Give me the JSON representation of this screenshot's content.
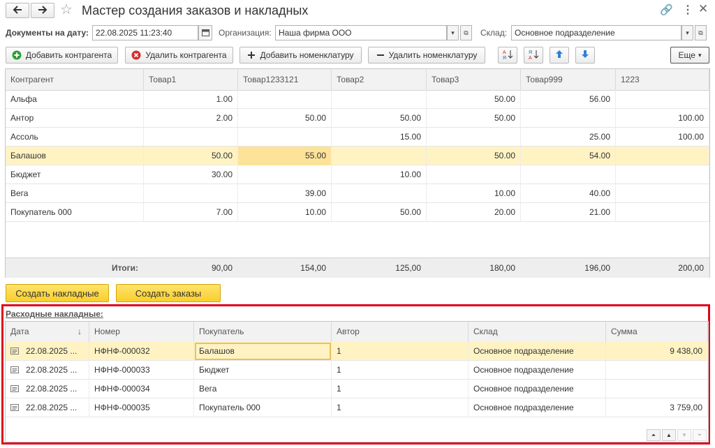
{
  "window": {
    "title": "Мастер создания заказов и накладных"
  },
  "filters": {
    "date_label": "Документы на дату:",
    "date_value": "22.08.2025 11:23:40",
    "org_label": "Организация:",
    "org_value": "Наша фирма ООО",
    "warehouse_label": "Склад:",
    "warehouse_value": "Основное подразделение"
  },
  "toolbar": {
    "add_counterparty": "Добавить контрагента",
    "remove_counterparty": "Удалить контрагента",
    "add_item": "Добавить номенклатуру",
    "remove_item": "Удалить номенклатуру",
    "more": "Еще"
  },
  "matrix": {
    "columns": [
      "Контрагент",
      "Товар1",
      "Товар1233121",
      "Товар2",
      "Товар3",
      "Товар999",
      "1223"
    ],
    "rows": [
      {
        "name": "Альфа",
        "values": [
          "1.00",
          "",
          "",
          "50.00",
          "56.00",
          ""
        ]
      },
      {
        "name": "Антор",
        "values": [
          "2.00",
          "50.00",
          "50.00",
          "50.00",
          "",
          "100.00"
        ]
      },
      {
        "name": "Ассоль",
        "values": [
          "",
          "",
          "15.00",
          "",
          "25.00",
          "100.00"
        ]
      },
      {
        "name": "Балашов",
        "values": [
          "50.00",
          "55.00",
          "",
          "50.00",
          "54.00",
          ""
        ]
      },
      {
        "name": "Бюджет",
        "values": [
          "30.00",
          "",
          "10.00",
          "",
          "",
          ""
        ]
      },
      {
        "name": "Вега",
        "values": [
          "",
          "39.00",
          "",
          "10.00",
          "40.00",
          ""
        ]
      },
      {
        "name": "Покупатель 000",
        "values": [
          "7.00",
          "10.00",
          "50.00",
          "20.00",
          "21.00",
          ""
        ]
      }
    ],
    "totals_label": "Итоги:",
    "totals": [
      "90,00",
      "154,00",
      "125,00",
      "180,00",
      "196,00",
      "200,00"
    ]
  },
  "actions": {
    "create_invoices": "Создать накладные",
    "create_orders": "Создать заказы"
  },
  "invoices": {
    "title": "Расходные накладные:",
    "columns": [
      "Дата",
      "Номер",
      "Покупатель",
      "Автор",
      "Склад",
      "Сумма"
    ],
    "rows": [
      {
        "date": "22.08.2025 ...",
        "number": "НФНФ-000032",
        "buyer": "Балашов",
        "author": "1",
        "warehouse": "Основное подразделение",
        "sum": "9 438,00"
      },
      {
        "date": "22.08.2025 ...",
        "number": "НФНФ-000033",
        "buyer": "Бюджет",
        "author": "1",
        "warehouse": "Основное подразделение",
        "sum": ""
      },
      {
        "date": "22.08.2025 ...",
        "number": "НФНФ-000034",
        "buyer": "Вега",
        "author": "1",
        "warehouse": "Основное подразделение",
        "sum": ""
      },
      {
        "date": "22.08.2025 ...",
        "number": "НФНФ-000035",
        "buyer": "Покупатель 000",
        "author": "1",
        "warehouse": "Основное подразделение",
        "sum": "3 759,00"
      }
    ]
  },
  "colors": {
    "selection": "#fff3c4",
    "highlight_border": "#e0021b",
    "accent_button": "#f9cf2b"
  }
}
